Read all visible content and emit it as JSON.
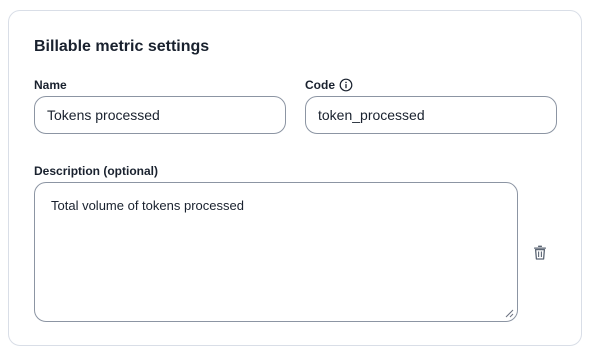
{
  "form": {
    "title": "Billable metric settings",
    "name": {
      "label": "Name",
      "value": "Tokens processed"
    },
    "code": {
      "label": "Code",
      "value": "token_processed",
      "icon": "info-icon"
    },
    "description": {
      "label": "Description (optional)",
      "value": "Total volume of tokens processed"
    },
    "delete_icon": "trash-icon"
  }
}
